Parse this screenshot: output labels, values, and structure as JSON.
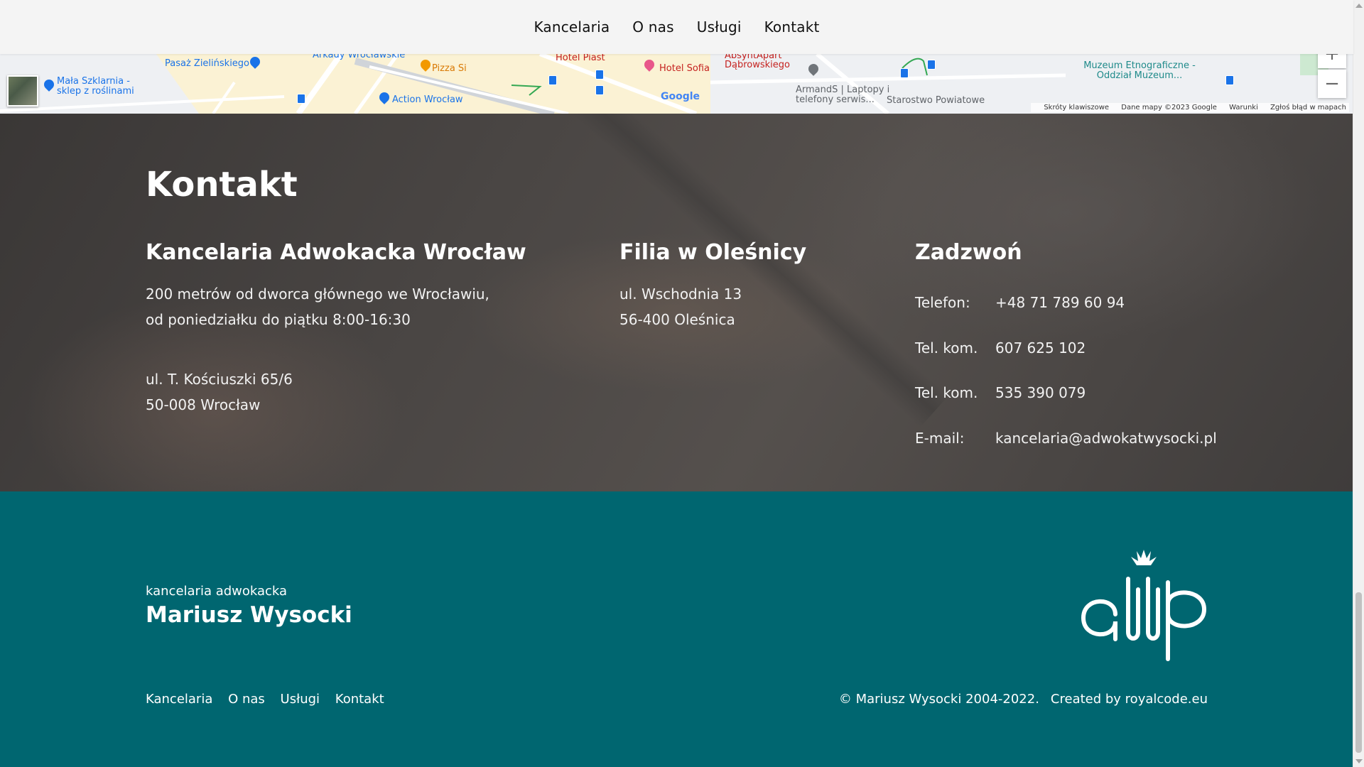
{
  "nav": {
    "items": [
      "Kancelaria",
      "O nas",
      "Usługi",
      "Kontakt"
    ]
  },
  "map": {
    "pois": [
      "Pasaż Zielińskiego",
      "Arkady Wrocławskie",
      "Pizza Si",
      "Action Wrocław",
      "Hotel Piast",
      "Hotel Sofia",
      "AbsyntApart Dąbrowskiego",
      "ArmandS | Laptopy i telefony serwis...",
      "Starostwo Powiatowe",
      "Muzeum Etnograficzne - Oddział Muzeum...",
      "Mała Szklarnia - sklep z roślinami"
    ],
    "google_label": "Google",
    "footer": {
      "shortcuts": "Skróty klawiszowe",
      "mapdata": "Dane mapy ©2023 Google",
      "terms": "Warunki",
      "report": "Zgłoś błąd w mapach"
    }
  },
  "contact": {
    "title": "Kontakt",
    "office": {
      "title": "Kancelaria Adwokacka Wrocław",
      "note_line1": "200 metrów od dworca głównego we Wrocławiu,",
      "note_line2": "od poniedziałku do piątku 8:00-16:30",
      "address_line1": "ul. T. Kościuszki 65/6",
      "address_line2": "50-008 Wrocław"
    },
    "branch": {
      "title": "Filia w Oleśnicy",
      "address_line1": "ul. Wschodnia 13",
      "address_line2": "56-400 Oleśnica"
    },
    "call": {
      "title": "Zadzwoń",
      "rows": [
        {
          "label": "Telefon:",
          "value": "+48 71 789 60 94"
        },
        {
          "label": "Tel. kom.",
          "value": "607 625 102"
        },
        {
          "label": "Tel. kom.",
          "value": "535 390 079"
        },
        {
          "label": "E-mail:",
          "value": "kancelaria@adwokatwysocki.pl"
        }
      ]
    }
  },
  "footer": {
    "subtitle": "kancelaria adwokacka",
    "name": "Mariusz Wysocki",
    "links": [
      "Kancelaria",
      "O nas",
      "Usługi",
      "Kontakt"
    ],
    "copyright": "© Mariusz Wysocki 2004-2022.",
    "created_by": "Created by royalcode.eu",
    "logo_text": "amw"
  }
}
